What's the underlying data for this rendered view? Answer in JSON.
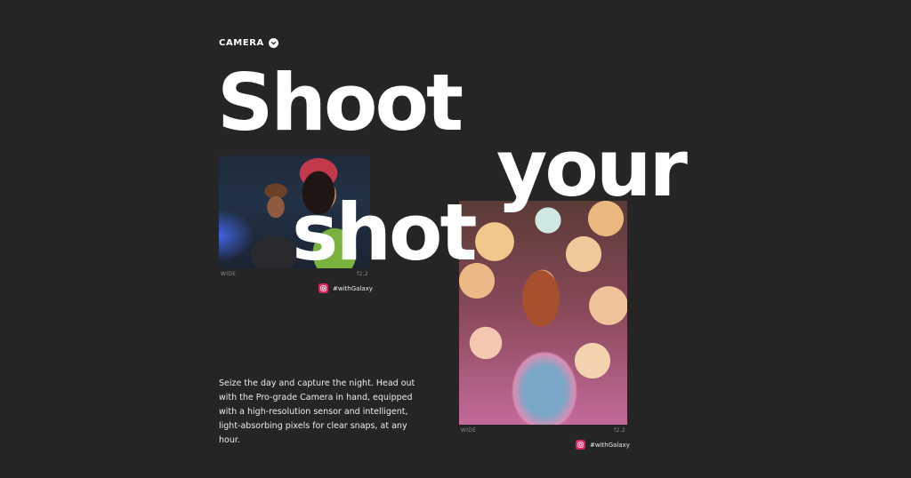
{
  "section": {
    "label": "CAMERA",
    "toggle_icon": "chevron-down-icon"
  },
  "headline": {
    "word1": "Shoot",
    "word2": "your",
    "word3": "shot"
  },
  "photos": [
    {
      "lens": "WIDE",
      "aperture": "f2.2",
      "tag": "#withGalaxy",
      "tag_icon": "instagram-icon"
    },
    {
      "lens": "WIDE",
      "aperture": "f2.2",
      "tag": "#withGalaxy",
      "tag_icon": "instagram-icon"
    }
  ],
  "body": {
    "text": "Seize the day and capture the night. Head out with the Pro-grade Camera in hand, equipped with a high-resolution sensor and intelligent, light-absorbing pixels for clear snaps, at any hour."
  },
  "colors": {
    "background": "#252525",
    "text": "#ffffff",
    "tag_accent": "#e0245e",
    "caption": "#8a8a8a"
  }
}
